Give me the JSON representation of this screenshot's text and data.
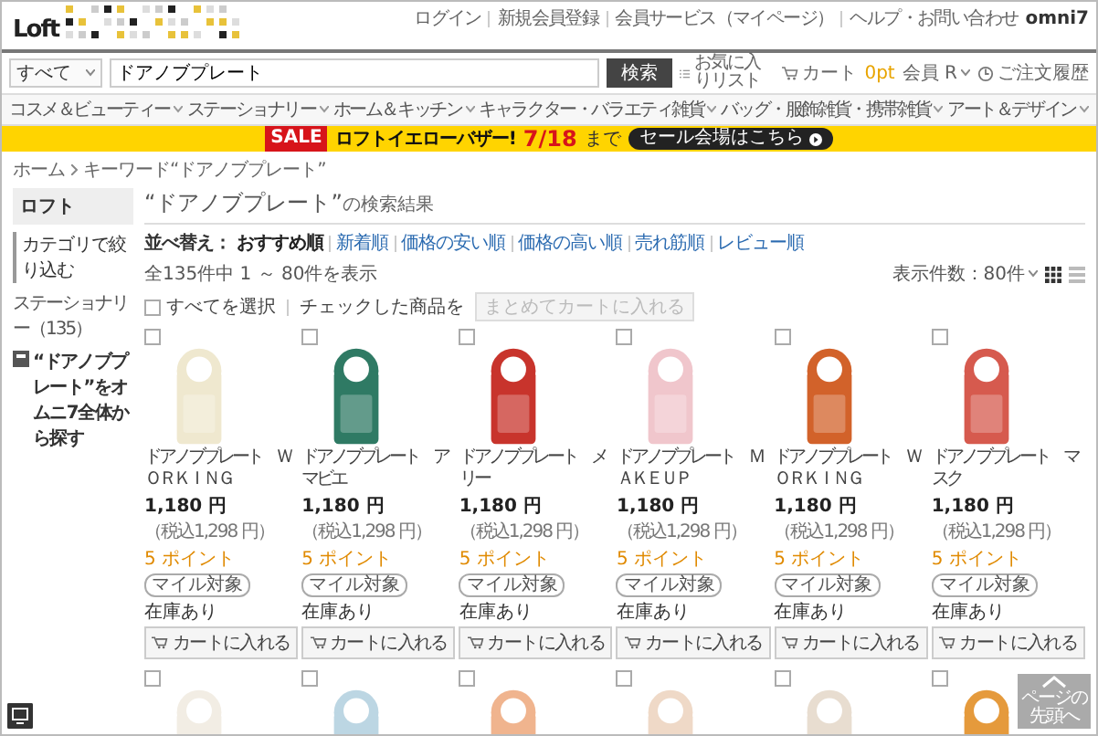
{
  "header": {
    "logo": "Loft",
    "links": [
      "ログイン",
      "新規会員登録",
      "会員サービス（マイページ）",
      "ヘルプ・お問い合わせ"
    ],
    "brand": "omni7"
  },
  "search": {
    "scope": "すべて",
    "value": "ドアノブプレート",
    "button": "検索",
    "favorites": "お気に入りリスト",
    "cart": "カート",
    "points": "0pt",
    "member": "会員 R",
    "orders": "ご注文履歴"
  },
  "nav": [
    "コスメ＆ビューティー",
    "ステーショナリー",
    "ホーム＆キッチン",
    "キャラクター・バラエティ雑貨",
    "バッグ・服飾雑貨・携帯雑貨",
    "アート＆デザイン"
  ],
  "banner": {
    "badge": "SALE",
    "title": "ロフトイエローバザー!",
    "date": "7/18",
    "suffix": "まで",
    "link": "セール会場はこちら"
  },
  "breadcrumb": [
    "ホーム",
    "キーワード“ドアノブプレート”"
  ],
  "sidebar": {
    "shop": "ロフト",
    "filter_heading": "カテゴリで絞り込む",
    "categories": [
      {
        "label": "ステーショナリー",
        "count": "（135）"
      }
    ],
    "omni_link": "“ドアノブプレート”をオムニ7全体から探す"
  },
  "results": {
    "keyword": "“ドアノブプレート”",
    "title_suffix": "の検索結果",
    "sort_label": "並べ替え：",
    "sort_options": [
      {
        "label": "おすすめ順",
        "selected": true
      },
      {
        "label": "新着順",
        "selected": false
      },
      {
        "label": "価格の安い順",
        "selected": false
      },
      {
        "label": "価格の高い順",
        "selected": false
      },
      {
        "label": "売れ筋順",
        "selected": false
      },
      {
        "label": "レビュー順",
        "selected": false
      }
    ],
    "count": "全135件中 1 ～ 80件を表示",
    "per_page": "表示件数：80件",
    "views": [
      {
        "kind": "grid",
        "selected": true
      },
      {
        "kind": "list",
        "selected": false
      }
    ],
    "select_all": {
      "label": "すべてを選択",
      "checked": false
    },
    "bulk_label": "チェックした商品を",
    "bulk_button": {
      "label": "まとめてカートに入れる",
      "disabled": true
    }
  },
  "products": [
    {
      "checked": false,
      "color": "#efe8cf",
      "name": "ドアノブプレート　ＷＯＲＫＩＮＧ",
      "price": "1,180 円",
      "tax": "（税込1,298 円）",
      "points": "5 ポイント",
      "badge": "マイル対象",
      "stock": "在庫あり",
      "button": "カートに入れる"
    },
    {
      "checked": false,
      "color": "#2f7a64",
      "name": "ドアノブプレート　アマビエ",
      "price": "1,180 円",
      "tax": "（税込1,298 円）",
      "points": "5 ポイント",
      "badge": "マイル対象",
      "stock": "在庫あり",
      "button": "カートに入れる"
    },
    {
      "checked": false,
      "color": "#c8342c",
      "name": "ドアノブプレート　メリー",
      "price": "1,180 円",
      "tax": "（税込1,298 円）",
      "points": "5 ポイント",
      "badge": "マイル対象",
      "stock": "在庫あり",
      "button": "カートに入れる"
    },
    {
      "checked": false,
      "color": "#f0c6cc",
      "name": "ドアノブプレート　ＭＡＫＥＵＰ",
      "price": "1,180 円",
      "tax": "（税込1,298 円）",
      "points": "5 ポイント",
      "badge": "マイル対象",
      "stock": "在庫あり",
      "button": "カートに入れる"
    },
    {
      "checked": false,
      "color": "#d2622a",
      "name": "ドアノブプレート　ＷＯＲＫＩＮＧ",
      "price": "1,180 円",
      "tax": "（税込1,298 円）",
      "points": "5 ポイント",
      "badge": "マイル対象",
      "stock": "在庫あり",
      "button": "カートに入れる"
    },
    {
      "checked": false,
      "color": "#d65a4e",
      "name": "ドアノブプレート　マスク",
      "price": "1,180 円",
      "tax": "（税込1,298 円）",
      "points": "5 ポイント",
      "badge": "マイル対象",
      "stock": "在庫あり",
      "button": "カートに入れる"
    },
    {
      "checked": false,
      "color": "#f2ede4"
    },
    {
      "checked": false,
      "color": "#bcd6e3"
    },
    {
      "checked": false,
      "color": "#f0b48e"
    },
    {
      "checked": false,
      "color": "#efd9c7"
    },
    {
      "checked": false,
      "color": "#e8ddd0"
    },
    {
      "checked": false,
      "color": "#e59a3c"
    }
  ],
  "page_top": "ページの先頭へ"
}
